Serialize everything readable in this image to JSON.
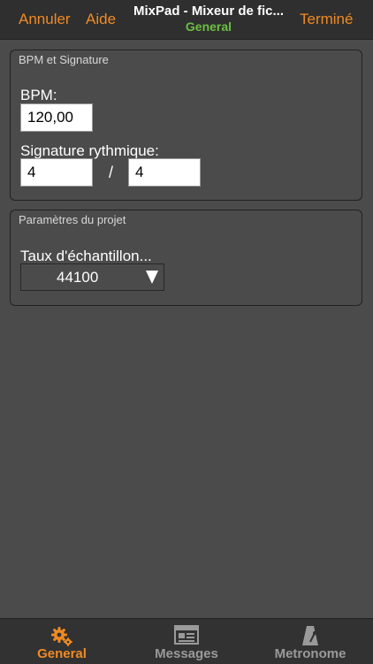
{
  "topbar": {
    "cancel_label": "Annuler",
    "help_label": "Aide",
    "title": "MixPad - Mixeur de fic...",
    "subtitle": "General",
    "done_label": "Terminé"
  },
  "bpm_group": {
    "title": "BPM et Signature",
    "bpm_label": "BPM:",
    "bpm_value": "120,00",
    "signature_label": "Signature rythmique:",
    "signature_numerator": "4",
    "signature_separator": "/",
    "signature_denominator": "4"
  },
  "project_group": {
    "title": "Paramètres du projet",
    "sample_rate_label": "Taux d'échantillon...",
    "sample_rate_value": "44100"
  },
  "tabbar": {
    "tabs": [
      {
        "label": "General",
        "icon": "gear-icon",
        "active": true
      },
      {
        "label": "Messages",
        "icon": "messages-icon",
        "active": false
      },
      {
        "label": "Metronome",
        "icon": "metronome-icon",
        "active": false
      }
    ]
  },
  "colors": {
    "accent": "#f08a24",
    "subtitle_green": "#6cbf43",
    "background": "#4b4b4b",
    "bar": "#2f2f2f",
    "inactive_tab": "#9a9a9a"
  }
}
